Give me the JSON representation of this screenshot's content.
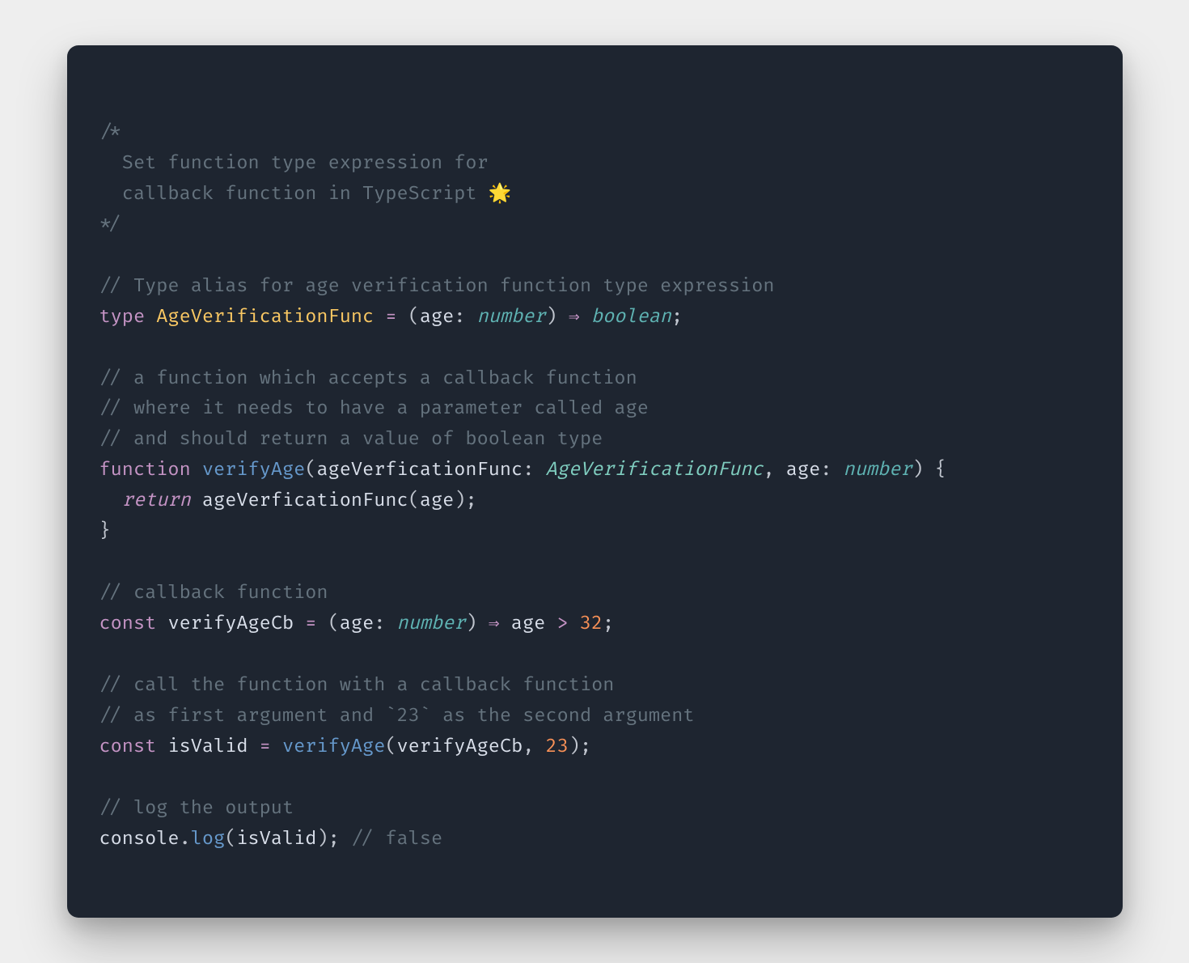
{
  "code": {
    "blockCommentOpen": "/*",
    "blockCommentLine1": "  Set function type expression for",
    "blockCommentLine2": "  callback function in TypeScript 🌟",
    "blockCommentClose": "*/",
    "comment1": "// Type alias for age verification function type expression",
    "typeKw": "type",
    "typeName": "AgeVerificationFunc",
    "eq": " = ",
    "open1": "(",
    "param1": "age",
    "colon": ": ",
    "numberType": "number",
    "close1": ")",
    "arrow": " ⇒ ",
    "booleanType": "boolean",
    "semi": ";",
    "comment2a": "// a function which accepts a callback function",
    "comment2b": "// where it needs to have a parameter called age",
    "comment2c": "// and should return a value of boolean type",
    "functionKw": "function",
    "verifyAge": "verifyAge",
    "openParen2": "(",
    "param2a": "ageVerficationFunc",
    "ageVerificationFuncType": "AgeVerificationFunc",
    "comma": ", ",
    "param2b": "age",
    "closeParen2": ")",
    "openBrace": " {",
    "returnKw": "return",
    "callExpr": "ageVerficationFunc",
    "callOpenParen": "(",
    "callArg": "age",
    "callCloseParen": ")",
    "closeBrace": "}",
    "comment3": "// callback function",
    "constKw": "const",
    "verifyAgeCb": "verifyAgeCb",
    "paramAge": "age",
    "gt": " > ",
    "num32": "32",
    "comment4a": "// call the function with a callback function",
    "comment4b": "// as first argument and `23` as the second argument",
    "isValid": "isValid",
    "num23": "23",
    "comment5": "// log the output",
    "consoleObj": "console",
    "dot": ".",
    "logFn": "log",
    "commentFalse": " // false",
    "space": " ",
    "indent": "  "
  }
}
